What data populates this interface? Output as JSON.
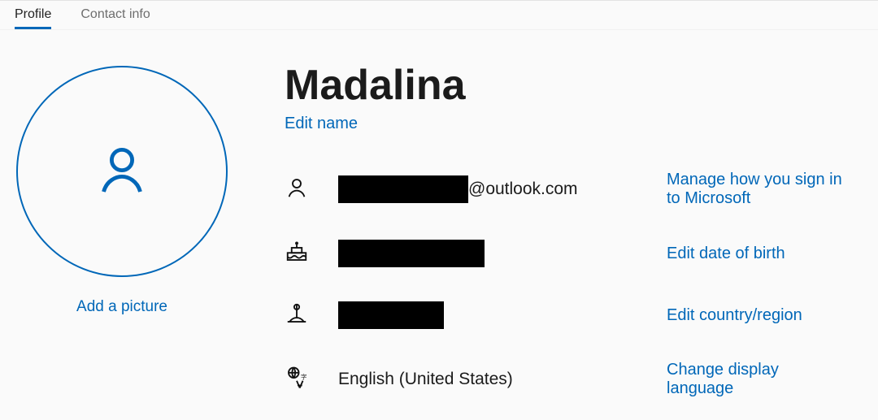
{
  "tabs": {
    "profile": "Profile",
    "contact": "Contact info"
  },
  "left": {
    "add_picture": "Add a picture"
  },
  "profile": {
    "display_name": "Madalina",
    "edit_name": "Edit name",
    "email_suffix": "@outlook.com",
    "language": "English (United States)"
  },
  "actions": {
    "manage_signin": "Manage how you sign in to Microsoft",
    "edit_dob": "Edit date of birth",
    "edit_region": "Edit country/region",
    "change_lang": "Change display language"
  }
}
